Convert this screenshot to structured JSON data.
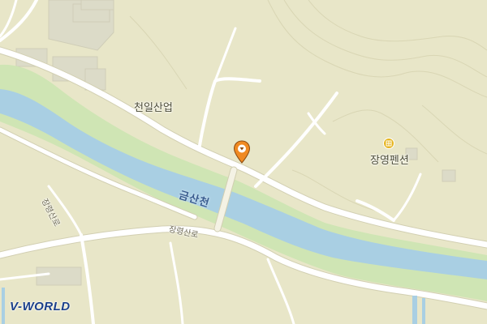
{
  "map": {
    "place_labels": {
      "company": "천일산업",
      "pension": "장영펜션"
    },
    "river_label": "금산천",
    "road_labels": {
      "diagonal": "장령산로",
      "lower": "장령산로"
    },
    "colors": {
      "land": "#e8e6c8",
      "river": "#a9cfe3",
      "riverbank": "#cfe5b4",
      "road": "#ffffff",
      "building": "#dcdbc8",
      "pin": "#f08a22",
      "poi": "#e6b520"
    },
    "icons": {
      "selected_location": "location-pin-icon",
      "pension_poi": "lodging-icon"
    }
  },
  "branding": {
    "logo_text": "V-WORLD"
  }
}
